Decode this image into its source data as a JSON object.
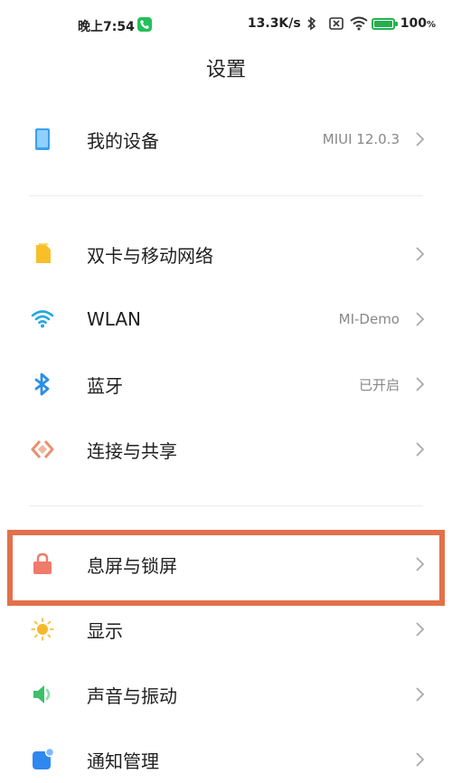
{
  "status_bar": {
    "time": "晚上7:54",
    "speed": "13.3K/s",
    "battery_pct": "100",
    "battery_unit": "%",
    "battery_level": 1.0,
    "icons": [
      "phone-icon",
      "bluetooth-icon",
      "sim-disabled-icon",
      "wifi-icon",
      "battery-icon"
    ]
  },
  "header": {
    "title": "设置"
  },
  "colors": {
    "device": "#3aa0f0",
    "sim": "#f7c028",
    "wifi": "#25a8df",
    "bluetooth": "#2b8fe8",
    "share": "#e8906e",
    "lock": "#ef7b6b",
    "display": "#f5b92b",
    "sound": "#3cc06a",
    "notify": "#2f87f0",
    "highlight": "#e3704a"
  },
  "settings": {
    "my_device": {
      "label": "我的设备",
      "value": "MIUI 12.0.3",
      "icon": "device-icon"
    },
    "sim_network": {
      "label": "双卡与移动网络",
      "value": "",
      "icon": "sim-card-icon"
    },
    "wlan": {
      "label": "WLAN",
      "value": "MI-Demo",
      "icon": "wifi-icon"
    },
    "bluetooth": {
      "label": "蓝牙",
      "value": "已开启",
      "icon": "bluetooth-icon"
    },
    "connection_share": {
      "label": "连接与共享",
      "value": "",
      "icon": "share-icon"
    },
    "lock_screen": {
      "label": "息屏与锁屏",
      "value": "",
      "icon": "lock-icon"
    },
    "display": {
      "label": "显示",
      "value": "",
      "icon": "sun-icon"
    },
    "sound": {
      "label": "声音与振动",
      "value": "",
      "icon": "speaker-icon"
    },
    "notifications": {
      "label": "通知管理",
      "value": "",
      "icon": "notification-icon"
    }
  }
}
